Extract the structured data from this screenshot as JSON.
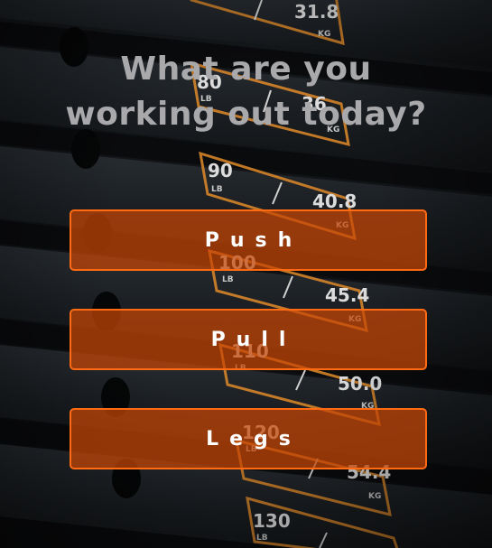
{
  "prompt": {
    "line1": "What are you",
    "line2": "working out today?"
  },
  "choices": {
    "push": "Push",
    "pull": "Pull",
    "legs": "Legs"
  },
  "background": {
    "plates": [
      {
        "lb": "",
        "kg": "31.8",
        "kg_unit": "KG"
      },
      {
        "lb": "80",
        "lb_unit": "LB",
        "kg": "36.",
        "kg_unit": "KG"
      },
      {
        "lb": "90",
        "lb_unit": "LB",
        "kg": "40.8",
        "kg_unit": "KG"
      },
      {
        "lb": "100",
        "lb_unit": "LB",
        "kg": "45.4",
        "kg_unit": "KG"
      },
      {
        "lb": "110",
        "lb_unit": "LB",
        "kg": "50.0",
        "kg_unit": "KG"
      },
      {
        "lb": "120",
        "lb_unit": "LB",
        "kg": "54.4",
        "kg_unit": "KG"
      },
      {
        "lb": "130",
        "lb_unit": "LB",
        "kg": "",
        "kg_unit": ""
      }
    ]
  },
  "colors": {
    "accent": "#ff6a12",
    "button_fill": "#c84605",
    "title": "#a9a9ab",
    "plate_label": "#e08a2a"
  }
}
